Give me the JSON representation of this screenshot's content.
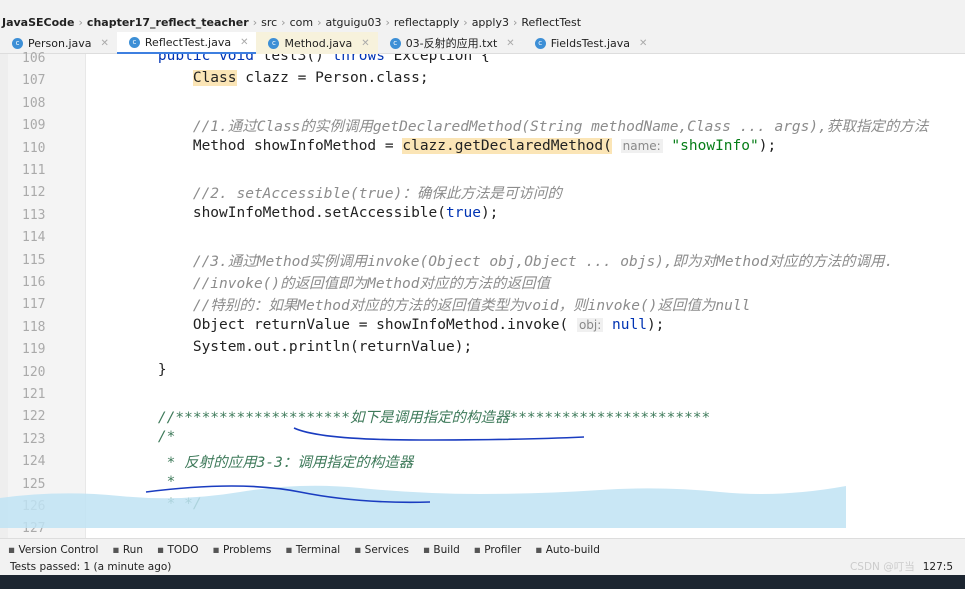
{
  "breadcrumb": [
    "JavaSECode",
    "chapter17_reflect_teacher",
    "src",
    "com",
    "atguigu03",
    "reflectapply",
    "apply3",
    "ReflectTest"
  ],
  "tabs": [
    {
      "label": "Person.java"
    },
    {
      "label": "ReflectTest.java"
    },
    {
      "label": "Method.java"
    },
    {
      "label": "03-反射的应用.txt"
    },
    {
      "label": "FieldsTest.java"
    }
  ],
  "lines": [
    {
      "n": "106",
      "t": "    public void test3() throws Exception {"
    },
    {
      "n": "107",
      "t": "        Class clazz = Person.class;"
    },
    {
      "n": "108",
      "t": ""
    },
    {
      "n": "109",
      "t": "        //1.通过Class的实例调用getDeclaredMethod(String methodName,Class ... args),获取指定的方法"
    },
    {
      "n": "110",
      "t": "        Method showInfoMethod = clazz.getDeclaredMethod( name: \"showInfo\");"
    },
    {
      "n": "111",
      "t": ""
    },
    {
      "n": "112",
      "t": "        //2. setAccessible(true)：确保此方法是可访问的"
    },
    {
      "n": "113",
      "t": "        showInfoMethod.setAccessible(true);"
    },
    {
      "n": "114",
      "t": ""
    },
    {
      "n": "115",
      "t": "        //3.通过Method实例调用invoke(Object obj,Object ... objs),即为对Method对应的方法的调用."
    },
    {
      "n": "116",
      "t": "        //invoke()的返回值即为Method对应的方法的返回值"
    },
    {
      "n": "117",
      "t": "        //特别的：如果Method对应的方法的返回值类型为void，则invoke()返回值为null"
    },
    {
      "n": "118",
      "t": "        Object returnValue = showInfoMethod.invoke( obj: null);"
    },
    {
      "n": "119",
      "t": "        System.out.println(returnValue);"
    },
    {
      "n": "120",
      "t": "    }"
    },
    {
      "n": "121",
      "t": ""
    },
    {
      "n": "122",
      "t": "    //********************如下是调用指定的构造器***********************"
    },
    {
      "n": "123",
      "t": "    /*"
    },
    {
      "n": "124",
      "t": "     * 反射的应用3-3：调用指定的构造器"
    },
    {
      "n": "125",
      "t": "     *"
    },
    {
      "n": "126",
      "t": "     * */"
    },
    {
      "n": "127",
      "t": ""
    }
  ],
  "bottom_tools": [
    "Version Control",
    "Run",
    "TODO",
    "Problems",
    "Terminal",
    "Services",
    "Build",
    "Profiler",
    "Auto-build"
  ],
  "status": {
    "text": "Tests passed: 1 (a minute ago)",
    "position": "127:5",
    "watermark": "CSDN @叮当"
  },
  "colors": {
    "accent": "#3d7fe0",
    "highlight": "#fbe5b6",
    "selection_overlay": "#bfe3f3"
  }
}
